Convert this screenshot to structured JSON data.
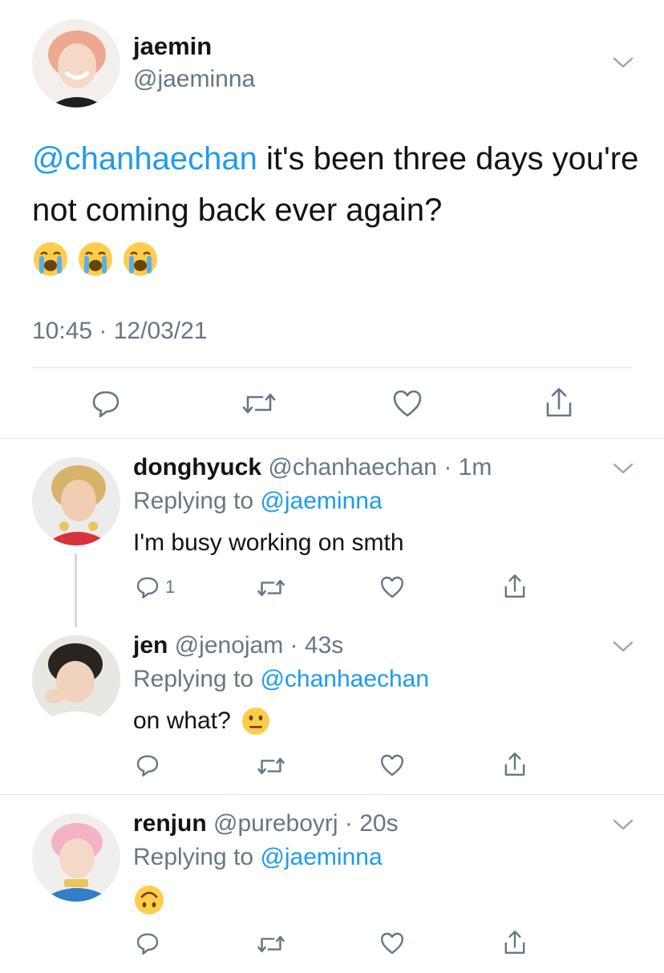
{
  "main_tweet": {
    "name": "jaemin",
    "handle": "@jaeminna",
    "mention": "@chanhaechan",
    "text": " it's been three days you're not coming back ever again?",
    "emojis": [
      "loudly-crying",
      "loudly-crying",
      "loudly-crying"
    ],
    "timestamp": "10:45 · 12/03/21"
  },
  "replies": [
    {
      "name": "donghyuck",
      "handle": "@chanhaechan",
      "time": "1m",
      "replying_prefix": "Replying to",
      "replying_to": "@jaeminna",
      "text": "I'm busy working on smth",
      "reply_count": "1"
    },
    {
      "name": "jen",
      "handle": "@jenojam",
      "time": "43s",
      "replying_prefix": "Replying to",
      "replying_to": "@chanhaechan",
      "text": "on what?",
      "emoji": "neutral-face"
    },
    {
      "name": "renjun",
      "handle": "@pureboyrj",
      "time": "20s",
      "replying_prefix": "Replying to",
      "replying_to": "@jaeminna",
      "text": "",
      "emoji": "upside-down-face"
    }
  ],
  "colors": {
    "link": "#1d9bf0",
    "muted": "#657786",
    "divider": "#dcdfe2"
  }
}
